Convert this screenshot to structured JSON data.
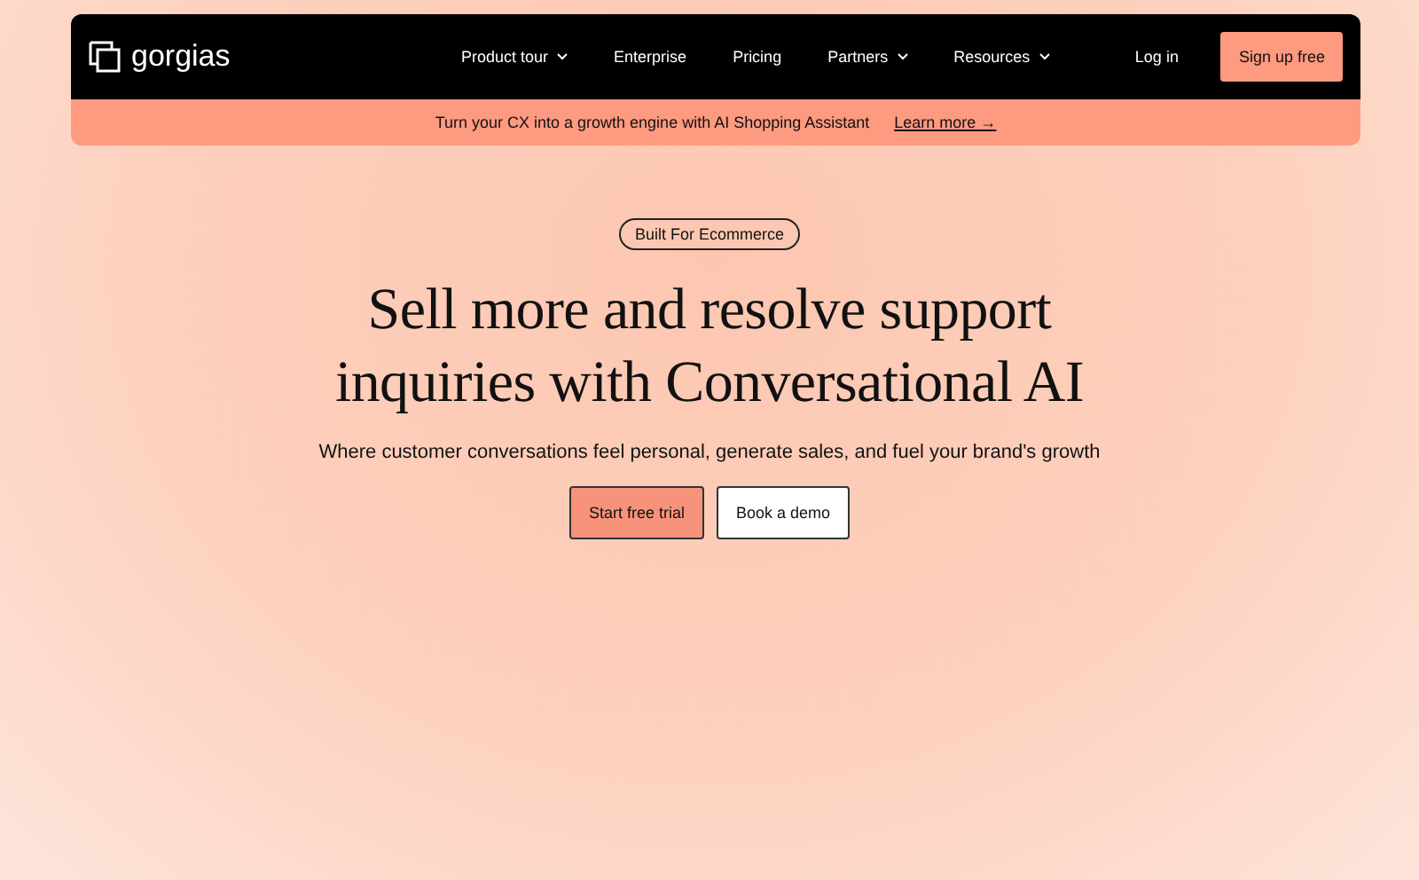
{
  "header": {
    "logo": "gorgias",
    "nav": [
      {
        "label": "Product tour",
        "dropdown": true
      },
      {
        "label": "Enterprise",
        "dropdown": false
      },
      {
        "label": "Pricing",
        "dropdown": false
      },
      {
        "label": "Partners",
        "dropdown": true
      },
      {
        "label": "Resources",
        "dropdown": true
      }
    ],
    "login": "Log in",
    "signup": "Sign up free"
  },
  "promo": {
    "text": "Turn your CX into a growth engine with AI Shopping Assistant",
    "link": "Learn more →"
  },
  "hero": {
    "badge": "Built For Ecommerce",
    "headline": [
      "Sell more and resolve support",
      "inquiries with Conversational AI"
    ],
    "subtitle": "Where customer conversations feel personal, generate sales, and fuel your brand's growth",
    "buttons": [
      {
        "label": "Start free trial",
        "kind": "primary"
      },
      {
        "label": "Book a demo",
        "kind": "secondary"
      }
    ]
  }
}
